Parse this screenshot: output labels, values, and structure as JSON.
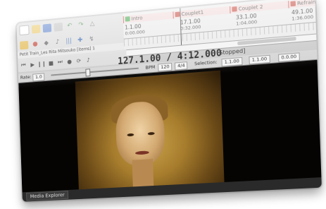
{
  "regions": [
    {
      "label": "Intro",
      "color": "#2e9e3a"
    },
    {
      "label": "Couplet1",
      "color": "#c0392b"
    },
    {
      "label": "Couplet 2",
      "color": "#c0392b"
    },
    {
      "label": "Refrain 1",
      "color": "#c0392b"
    }
  ],
  "positions": [
    {
      "bar": "1.1.00",
      "time": "0:00.000"
    },
    {
      "bar": "17.1.00",
      "time": "0:32.000"
    },
    {
      "bar": "33.1.00",
      "time": "1:04.000"
    },
    {
      "bar": "49.1.00",
      "time": "1:36.000"
    }
  ],
  "project_tab": "Petit Train_Les Rita Mitsouko [items] 1",
  "transport": {
    "position_time": "127.1.00 / 4:12.000",
    "state": "[Stopped]"
  },
  "row3": {
    "rate_label": "Rate:",
    "rate_value": "1.0",
    "bpm_label": "BPM",
    "bpm_value": "120",
    "time_sig": "4/4",
    "selection_label": "Selection:",
    "sel_start": "1.1.00",
    "sel_end": "1.1.00",
    "sel_length": "0.0.00"
  },
  "bottom": {
    "tab_label": "Media Explorer"
  }
}
